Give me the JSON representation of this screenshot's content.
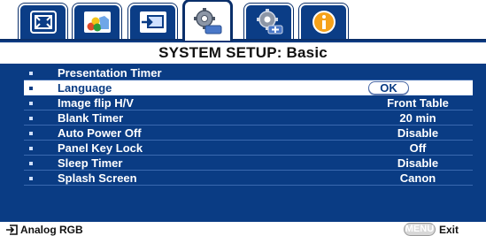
{
  "tabs": [
    {
      "icon": "picture-icon",
      "active": false
    },
    {
      "icon": "color-image-icon",
      "active": false
    },
    {
      "icon": "input-source-icon",
      "active": false
    },
    {
      "icon": "gear-icon",
      "active": true
    },
    {
      "icon": "advanced-settings-icon",
      "active": false
    },
    {
      "icon": "info-icon",
      "active": false
    }
  ],
  "title": "SYSTEM SETUP: Basic",
  "items": [
    {
      "label": "Presentation Timer",
      "value": ""
    },
    {
      "label": "Language",
      "value": "OK"
    },
    {
      "label": "Image flip H/V",
      "value": "Front Table"
    },
    {
      "label": "Blank Timer",
      "value": "20 min"
    },
    {
      "label": "Auto Power Off",
      "value": "Disable"
    },
    {
      "label": "Panel Key Lock",
      "value": "Off"
    },
    {
      "label": "Sleep Timer",
      "value": "Disable"
    },
    {
      "label": "Splash Screen",
      "value": "Canon"
    }
  ],
  "selected_index": 1,
  "footer": {
    "source": "Analog RGB",
    "menu_key": "MENU",
    "exit": "Exit"
  },
  "colors": {
    "panel": "#0a3c84",
    "selected_row": "#ffffff",
    "text": "#ffffff"
  }
}
